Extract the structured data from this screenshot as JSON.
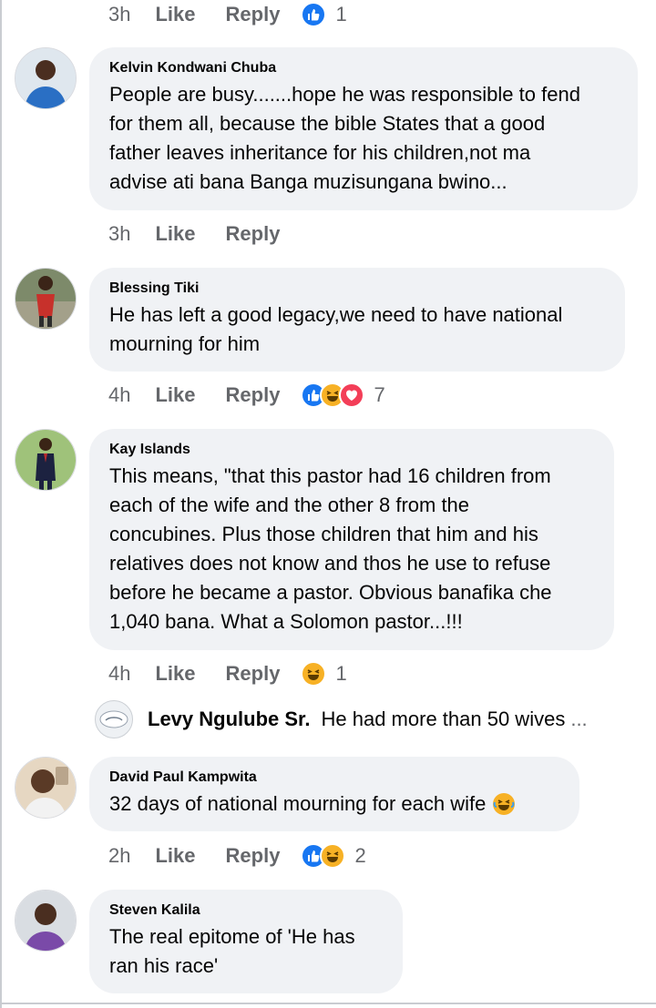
{
  "top": {
    "time": "3h",
    "like": "Like",
    "reply": "Reply",
    "count": "1"
  },
  "comments": [
    {
      "name": "Kelvin Kondwani Chuba",
      "lines": [
        "People are busy.......hope he was responsible to fend",
        "for them all, because the bible States that a good",
        "father leaves inheritance for his children,not ma",
        "advise ati bana Banga muzisungana bwino..."
      ],
      "time": "3h",
      "like": "Like",
      "reply": "Reply",
      "count": "",
      "reactions": []
    },
    {
      "name": "Blessing Tiki",
      "lines": [
        "He has left a good legacy,we need to have national",
        "mourning for him"
      ],
      "time": "4h",
      "like": "Like",
      "reply": "Reply",
      "count": "7",
      "reactions": [
        "like",
        "haha",
        "love"
      ]
    },
    {
      "name": "Kay Islands",
      "lines": [
        "This means, \"that this pastor had 16 children from",
        "each of the wife and the other 8 from the",
        "concubines. Plus those children that him and his",
        "relatives does not know and thos he use to refuse",
        "before he became a pastor. Obvious banafika che",
        "1,040 bana. What a Solomon pastor...!!!"
      ],
      "time": "4h",
      "like": "Like",
      "reply": "Reply",
      "count": "1",
      "reactions": [
        "haha"
      ]
    },
    {
      "name": "David Paul Kampwita",
      "lines": [
        "32 days of national mourning for each wife"
      ],
      "time": "2h",
      "like": "Like",
      "reply": "Reply",
      "count": "2",
      "reactions": [
        "like",
        "haha"
      ]
    },
    {
      "name": "Steven Kalila",
      "lines": [
        "The real epitome of 'He has",
        "ran his race'"
      ],
      "time": "",
      "like": "",
      "reply": "",
      "count": "",
      "reactions": []
    }
  ],
  "reply_preview": {
    "name": "Levy Ngulube Sr.",
    "text": "He had more than 50 wives",
    "ellipsis": "..."
  },
  "colors": {
    "bubble": "#f0f2f5",
    "meta": "#65676b",
    "like_blue": "#1877f2",
    "love_red": "#f33e58",
    "haha_yellow": "#f7b125"
  },
  "icons": {
    "like": "thumbs-up-icon",
    "haha": "laughing-emoji-icon",
    "love": "heart-icon",
    "tears": "tears-of-joy-emoji-icon"
  }
}
